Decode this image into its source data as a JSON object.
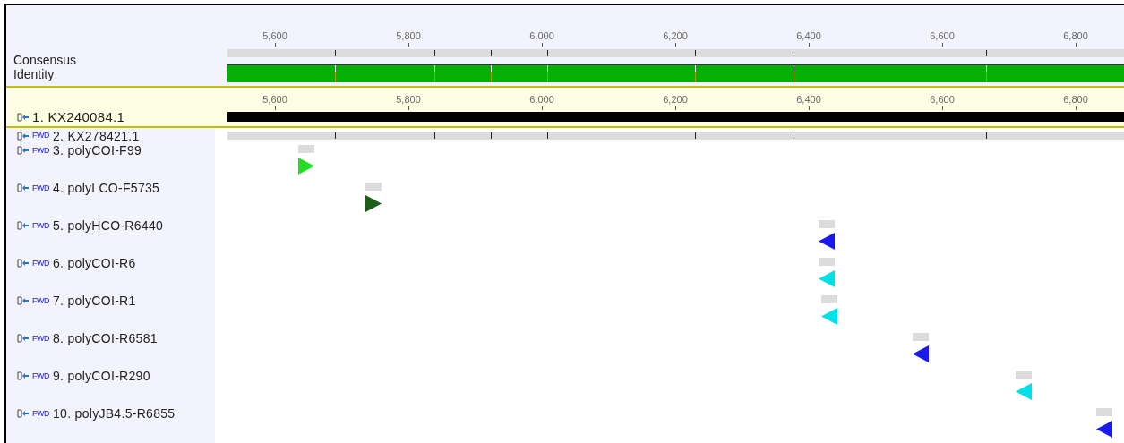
{
  "header": {
    "labels": [
      "Consensus",
      "Identity"
    ],
    "ruler": [
      "5,600",
      "5,800",
      "6,000",
      "6,200",
      "6,400",
      "6,600",
      "6,800"
    ]
  },
  "reference_ruler": [
    "5,600",
    "5,800",
    "6,000",
    "6,200",
    "6,400",
    "6,600",
    "6,800"
  ],
  "sequences": [
    {
      "name": "1. KX240084.1",
      "kind": "reference",
      "selected": true
    },
    {
      "name": "2. KX278421.1",
      "kind": "full",
      "tag": "FWD",
      "selected": false
    },
    {
      "name": "3. polyCOI-F99",
      "kind": "forward_primer",
      "tag": "FWD",
      "color": "#22dd22",
      "selected": false
    },
    {
      "name": "4. polyLCO-F5735",
      "kind": "forward_primer",
      "tag": "FWD",
      "color": "#1b5e1b",
      "selected": false
    },
    {
      "name": "5. polyHCO-R6440",
      "kind": "reverse_primer",
      "tag": "FWD",
      "color": "#1a1aee",
      "selected": false
    },
    {
      "name": "6. polyCOI-R6",
      "kind": "reverse_primer",
      "tag": "FWD",
      "color": "#00e0e8",
      "selected": false
    },
    {
      "name": "7. polyCOI-R1",
      "kind": "reverse_primer",
      "tag": "FWD",
      "color": "#00e0e8",
      "selected": false
    },
    {
      "name": "8. polyCOI-R6581",
      "kind": "reverse_primer",
      "tag": "FWD",
      "color": "#1a1aee",
      "selected": false
    },
    {
      "name": "9. polyCOI-R290",
      "kind": "reverse_primer",
      "tag": "FWD",
      "color": "#00e0e8",
      "selected": false
    },
    {
      "name": "10. polyJB4.5-R6855",
      "kind": "reverse_primer",
      "tag": "FWD",
      "color": "#1a1aee",
      "selected": false
    }
  ]
}
